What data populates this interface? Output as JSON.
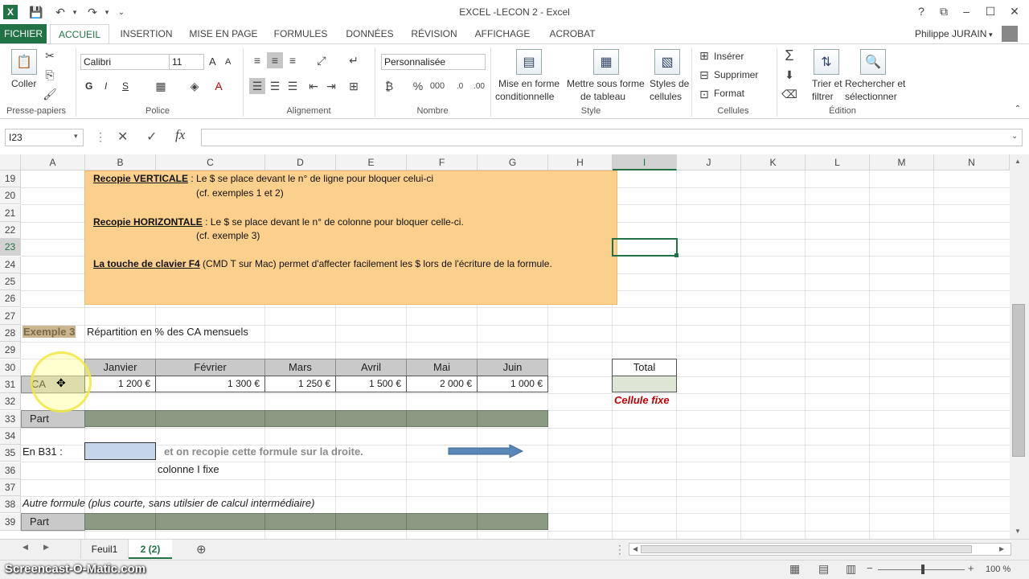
{
  "window": {
    "title": "EXCEL -LECON 2 - Excel",
    "user": "Philippe JURAIN",
    "help": "?",
    "min": "–",
    "max": "☐",
    "close": "✕"
  },
  "tabs": [
    "FICHIER",
    "ACCUEIL",
    "INSERTION",
    "MISE EN PAGE",
    "FORMULES",
    "DONNÉES",
    "RÉVISION",
    "AFFICHAGE",
    "ACROBAT"
  ],
  "ribbon": {
    "paste_label": "Coller",
    "clipboard_group": "Presse-papiers",
    "font_name": "Calibri",
    "font_size": "11",
    "bold": "G",
    "italic": "I",
    "underline": "S",
    "grow": "A",
    "shrink": "A",
    "font_group": "Police",
    "alignment_group": "Alignement",
    "number_format": "Personnalisée",
    "number_group": "Nombre",
    "cond_format_1": "Mise en forme",
    "cond_format_2": "conditionnelle",
    "table_format_1": "Mettre sous forme",
    "table_format_2": "de tableau",
    "cell_styles_1": "Styles de",
    "cell_styles_2": "cellules",
    "style_group": "Style",
    "insert": "Insérer",
    "delete": "Supprimer",
    "format": "Format",
    "cells_group": "Cellules",
    "sort_1": "Trier et",
    "sort_2": "filtrer",
    "find_1": "Rechercher et",
    "find_2": "sélectionner",
    "editing_group": "Édition"
  },
  "formula_bar": {
    "name_box": "I23",
    "cancel": "✕",
    "enter": "✓",
    "fx": "fx",
    "value": ""
  },
  "columns": [
    "A",
    "B",
    "C",
    "D",
    "E",
    "F",
    "G",
    "H",
    "I",
    "J",
    "K",
    "L",
    "M",
    "N"
  ],
  "rows": [
    "19",
    "20",
    "21",
    "22",
    "23",
    "24",
    "25",
    "26",
    "27",
    "28",
    "29",
    "30",
    "31",
    "32",
    "33",
    "34",
    "35",
    "36",
    "37",
    "38",
    "39"
  ],
  "note": {
    "vert_title": "Recopie VERTICALE",
    "vert_text": " : Le $ se place devant le n° de ligne pour bloquer celui-ci",
    "vert_ex": "(cf. exemples 1 et 2)",
    "horiz_title": "Recopie HORIZONTALE",
    "horiz_text": " : Le $ se place devant le n° de colonne pour bloquer celle-ci.",
    "horiz_ex": "(cf. exemple 3)",
    "f4_title": "La touche de clavier F4",
    "f4_text": " (CMD T sur Mac) permet d'affecter facilement les $ lors de l'écriture de la formule."
  },
  "sheet": {
    "example_label": "Exemple 3",
    "example_desc": "Répartition en % des CA mensuels",
    "months": [
      "Janvier",
      "Février",
      "Mars",
      "Avril",
      "Mai",
      "Juin"
    ],
    "total": "Total",
    "ca_label": "CA",
    "ca_values": [
      "1 200 €",
      "1 300 €",
      "1 250 €",
      "1 500 €",
      "2 000 €",
      "1 000 €"
    ],
    "fixed_cell": "Cellule fixe",
    "part_label": "Part",
    "en_b31": "En B31 :",
    "recopy_text": "et on recopie cette formule sur la droite.",
    "col_fixed": "colonne I fixe",
    "other_formula": "Autre formule (plus courte, sans utilsier de calcul intermédiaire)",
    "part_label_2": "Part"
  },
  "sheet_tabs": [
    "Feuil1",
    "2 (2)"
  ],
  "status": {
    "watermark": "Screencast-O-Matic.com",
    "zoom": "100 %"
  },
  "colors": {
    "accent": "#217346",
    "note_fill": "#fbd08d",
    "header_gray": "#c9c9c9",
    "part_green": "#8c9a83",
    "fixed_red": "#c00000"
  }
}
